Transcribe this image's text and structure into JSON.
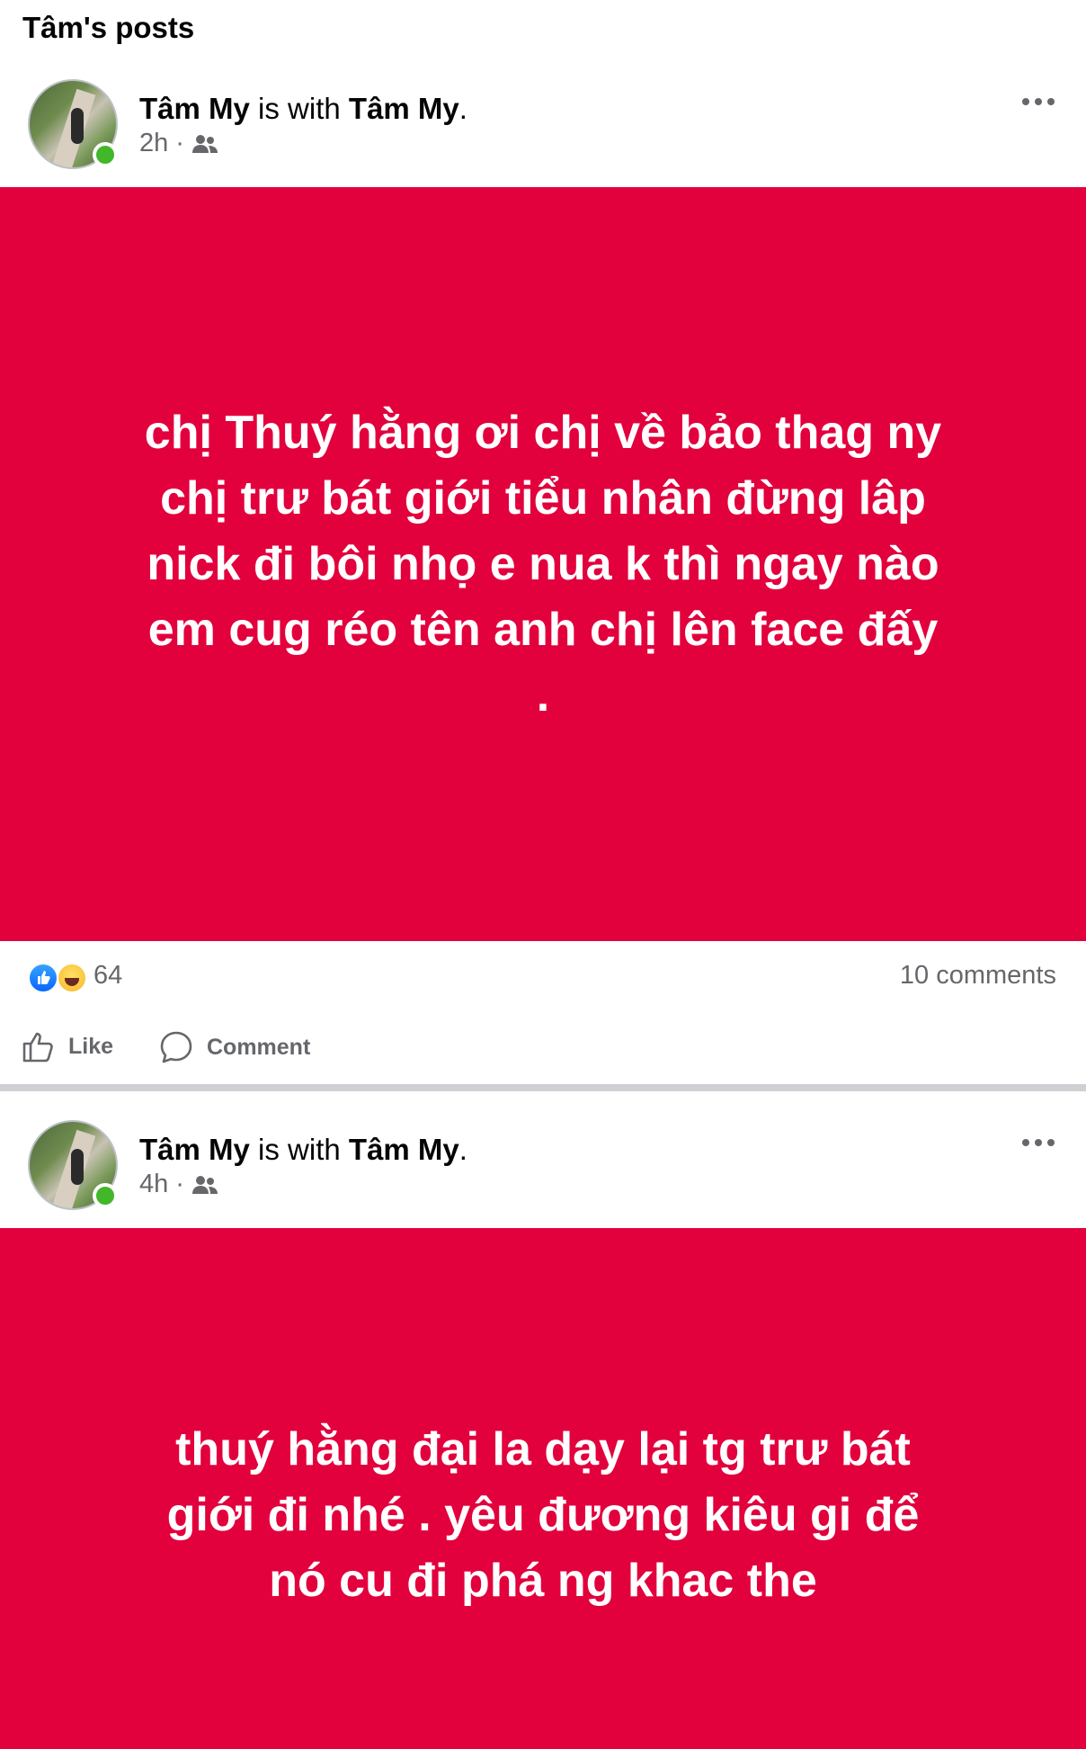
{
  "page": {
    "section_title": "Tâm's posts"
  },
  "posts": [
    {
      "author": "Tâm My",
      "with_text": "is with",
      "tagged": "Tâm My",
      "period": ".",
      "time": "2h",
      "audience_icon": "friends-icon",
      "content": "chị Thuý hằng ơi chị về bảo thag ny\nchị trư bát giới tiểu nhân đừng lâp\nnick đi bôi nhọ e nua k thì ngay nào\nem cug réo tên anh chị lên face đấy\n.",
      "background_color": "#e2003d",
      "reaction_count": "64",
      "comments": "10 comments",
      "like_label": "Like",
      "comment_label": "Comment"
    },
    {
      "author": "Tâm My",
      "with_text": "is with",
      "tagged": "Tâm My",
      "period": ".",
      "time": "4h",
      "audience_icon": "friends-icon",
      "content": "thuý hằng đại la dạy lại tg trư bát\ngiới đi nhé . yêu đương kiêu gi để\nnó cu đi phá ng khac the",
      "background_color": "#e2003d"
    }
  ]
}
